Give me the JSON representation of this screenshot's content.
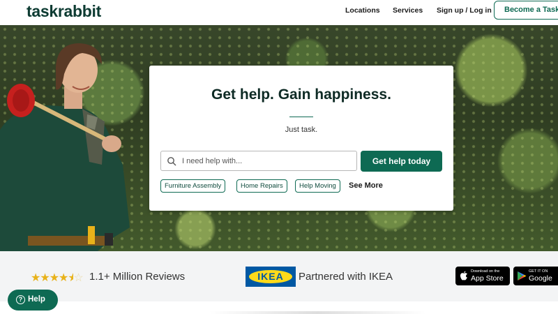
{
  "header": {
    "logo": "taskrabbit",
    "nav": {
      "locations": "Locations",
      "services": "Services",
      "signup_login": "Sign up / Log in"
    },
    "cta": "Become a Task"
  },
  "hero": {
    "title": "Get help. Gain happiness.",
    "subtitle": "Just task.",
    "search": {
      "placeholder": "I need help with...",
      "value": ""
    },
    "button": "Get help today",
    "chips": [
      "Furniture Assembly",
      "Home Repairs",
      "Help Moving"
    ],
    "see_more": "See More"
  },
  "trust": {
    "rating_stars": 4.5,
    "reviews": "1.1+ Million Reviews",
    "ikea_logo_text": "IKEA",
    "partner": "Partnered with IKEA",
    "app_store": {
      "small": "Download on the",
      "big": "App Store"
    },
    "google_play": {
      "small": "GET IT ON",
      "big": "Google"
    }
  },
  "help_fab": {
    "label": "Help",
    "icon": "question-circle-icon"
  },
  "colors": {
    "brand_green": "#0e6a53",
    "logo_dark": "#0d3b32",
    "star_gold": "#e8b21a",
    "ikea_blue": "#0058a3",
    "ikea_yellow": "#ffda1a"
  }
}
